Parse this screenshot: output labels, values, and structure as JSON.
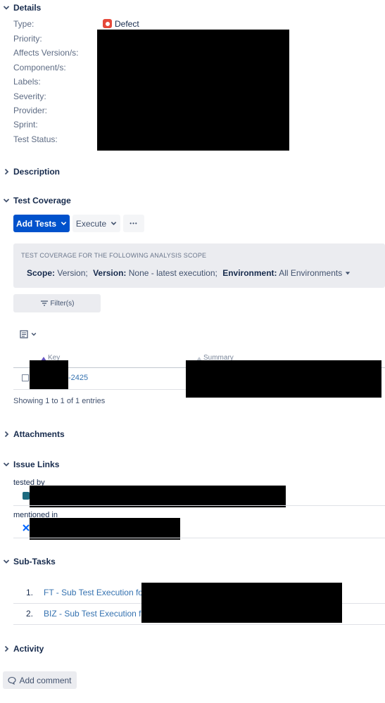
{
  "details": {
    "title": "Details",
    "type_label": "Type:",
    "type_value": "Defect",
    "priority_label": "Priority:",
    "affects_label": "Affects Version/s:",
    "component_label": "Component/s:",
    "labels_label": "Labels:",
    "severity_label": "Severity:",
    "provider_label": "Provider:",
    "sprint_label": "Sprint:",
    "test_status_label": "Test Status:"
  },
  "description": {
    "title": "Description"
  },
  "test_coverage": {
    "title": "Test Coverage",
    "add_tests_label": "Add Tests",
    "execute_label": "Execute",
    "more_label": "•••",
    "scope_heading": "TEST COVERAGE FOR THE FOLLOWING ANALYSIS SCOPE",
    "scope_label": "Scope:",
    "scope_value": "Version;",
    "version_label": "Version:",
    "version_value": "None - latest execution;",
    "environment_label": "Environment:",
    "environment_value": "All Environments",
    "filter_label": "Filter(s)",
    "table": {
      "col_key": "Key",
      "col_summary": "Summary",
      "row_key_suffix": "-2425"
    },
    "showing_text": "Showing 1 to 1 of 1 entries"
  },
  "attachments": {
    "title": "Attachments"
  },
  "issue_links": {
    "title": "Issue Links",
    "tested_by_label": "tested by",
    "mentioned_in_label": "mentioned in"
  },
  "subtasks": {
    "title": "Sub-Tasks",
    "items": [
      {
        "num": "1.",
        "label": "FT - Sub Test Execution for F"
      },
      {
        "num": "2.",
        "label": "BIZ - Sub Test Execution for"
      }
    ]
  },
  "activity": {
    "title": "Activity",
    "add_comment_label": "Add comment"
  },
  "colors": {
    "primary_button": "#0052cc",
    "link": "#3572b0",
    "defect_icon": "#e5493a",
    "text": "#172b4d",
    "muted": "#5e6c84"
  }
}
